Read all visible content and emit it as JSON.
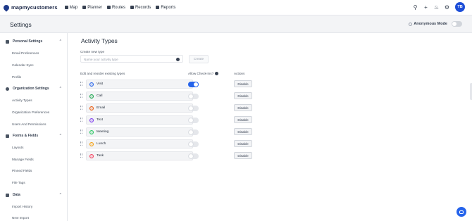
{
  "app": {
    "logo_text": "mapmycustomers",
    "nav": [
      {
        "label": "Map",
        "icon": "map-icon"
      },
      {
        "label": "Planner",
        "icon": "calendar-icon"
      },
      {
        "label": "Routes",
        "icon": "car-icon"
      },
      {
        "label": "Records",
        "icon": "records-icon"
      },
      {
        "label": "Reports",
        "icon": "reports-icon"
      }
    ],
    "user_initials": "TB"
  },
  "settings": {
    "title": "Settings",
    "anonymous_mode_label": "Anonymous Mode",
    "anonymous_mode_on": false
  },
  "sidebar": {
    "sections": [
      {
        "label": "Personal Settings",
        "icon": "user-icon",
        "items": [
          "Email Preferences",
          "Calendar Sync",
          "Profile"
        ]
      },
      {
        "label": "Organization Settings",
        "icon": "globe-icon",
        "items": [
          "Activity Types",
          "Organization Preferences",
          "Users And Permissions"
        ]
      },
      {
        "label": "Forms & Fields",
        "icon": "pencil-icon",
        "items": [
          "Layouts",
          "Manage Fields",
          "Pinned Fields",
          "File Tags"
        ]
      },
      {
        "label": "Data",
        "icon": "database-icon",
        "items": [
          "Import History",
          "New Import"
        ]
      }
    ]
  },
  "main": {
    "title": "Activity Types",
    "create_label": "Create new type",
    "create_placeholder": "Name your activity type",
    "create_button": "Create",
    "list_label": "Edit and reorder existing types",
    "checkin_header": "Allow Check-Ins?",
    "actions_header": "Actions",
    "types": [
      {
        "name": "Visit",
        "color": "#2563eb",
        "checkin": true,
        "action": "Disable"
      },
      {
        "name": "Call",
        "color": "#16a34a",
        "checkin": false,
        "action": "Disable"
      },
      {
        "name": "Email",
        "color": "#ea580c",
        "checkin": false,
        "action": "Disable"
      },
      {
        "name": "Text",
        "color": "#7c3aed",
        "checkin": false,
        "action": "Disable"
      },
      {
        "name": "Meeting",
        "color": "#22c55e",
        "checkin": false,
        "action": "Disable"
      },
      {
        "name": "Lunch",
        "color": "#f59e0b",
        "checkin": false,
        "action": "Disable"
      },
      {
        "name": "Task",
        "color": "#f43f5e",
        "checkin": false,
        "action": "Disable"
      }
    ]
  }
}
